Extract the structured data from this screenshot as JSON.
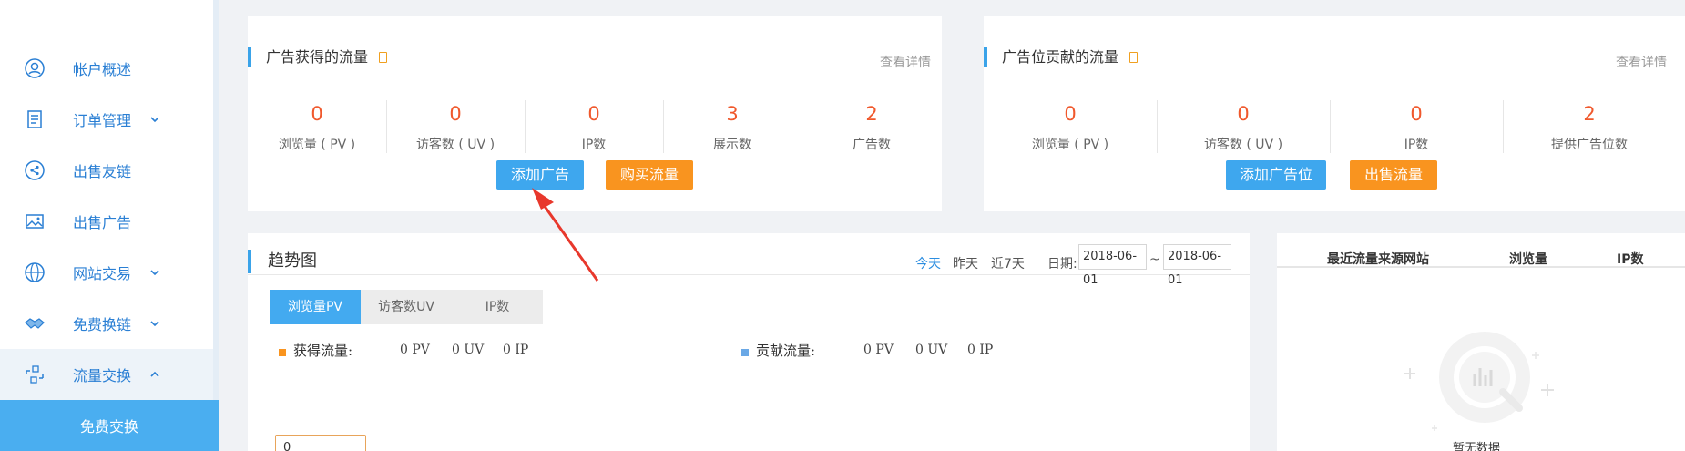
{
  "sidebar": {
    "items": [
      {
        "label": "帐户概述",
        "icon": "user-circle-icon"
      },
      {
        "label": "订单管理",
        "icon": "document-icon"
      },
      {
        "label": "出售友链",
        "icon": "share-icon"
      },
      {
        "label": "出售广告",
        "icon": "image-icon"
      },
      {
        "label": "网站交易",
        "icon": "globe-icon"
      },
      {
        "label": "免费换链",
        "icon": "handshake-icon"
      },
      {
        "label": "流量交换",
        "icon": "exchange-icon"
      }
    ],
    "sub_item": {
      "label": "免费交换"
    }
  },
  "ad_traffic": {
    "title": "广告获得的流量",
    "detail_link": "查看详情",
    "stats": [
      {
        "value": "0",
        "label": "浏览量 ( PV )"
      },
      {
        "value": "0",
        "label": "访客数 ( UV )"
      },
      {
        "value": "0",
        "label": "IP数"
      },
      {
        "value": "3",
        "label": "展示数"
      },
      {
        "value": "2",
        "label": "广告数"
      }
    ],
    "buttons": {
      "primary": "添加广告",
      "secondary": "购买流量"
    }
  },
  "slot_traffic": {
    "title": "广告位贡献的流量",
    "detail_link": "查看详情",
    "stats": [
      {
        "value": "0",
        "label": "浏览量 ( PV )"
      },
      {
        "value": "0",
        "label": "访客数 ( UV )"
      },
      {
        "value": "0",
        "label": "IP数"
      },
      {
        "value": "2",
        "label": "提供广告位数"
      }
    ],
    "buttons": {
      "primary": "添加广告位",
      "secondary": "出售流量"
    }
  },
  "trend": {
    "title": "趋势图",
    "filters": [
      "今天",
      "昨天",
      "近7天"
    ],
    "active_filter": "今天",
    "date_label": "日期:",
    "date_from": "2018-06-01",
    "date_sep": "~",
    "date_to": "2018-06-01",
    "tabs": [
      "浏览量PV",
      "访客数UV",
      "IP数"
    ],
    "active_tab": "浏览量PV",
    "legend": [
      {
        "label": "获得流量:",
        "pv": "0 PV",
        "uv": "0 UV",
        "ip": "0 IP",
        "color": "#f9941f"
      },
      {
        "label": "贡献流量:",
        "pv": "0 PV",
        "uv": "0 UV",
        "ip": "0 IP",
        "color": "#6aa8e6"
      }
    ],
    "axis_input_value": "0"
  },
  "sources": {
    "headers": [
      "最近流量来源网站",
      "浏览量",
      "IP数"
    ],
    "empty_text": "暂无数据"
  },
  "colors": {
    "accent": "#3ea7ee",
    "orange": "#f9941f",
    "stat": "#f0582c"
  }
}
